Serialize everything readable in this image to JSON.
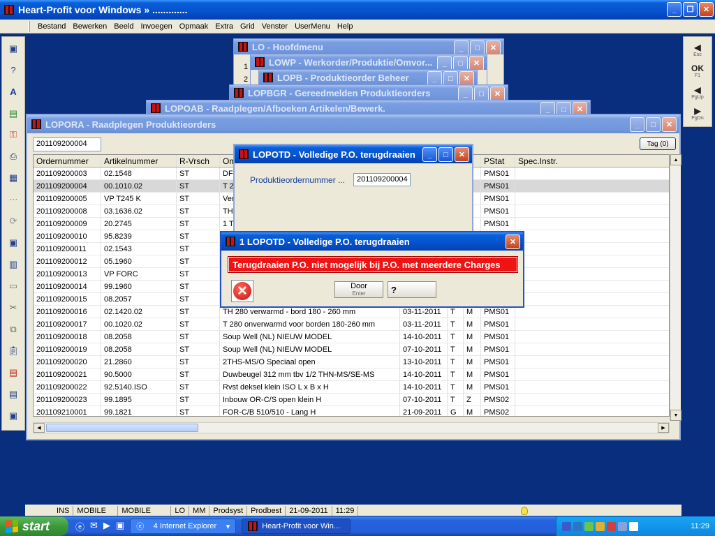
{
  "app": {
    "title": "Heart-Profit voor Windows  »  .............",
    "controls": [
      "minimize-icon",
      "restore-icon",
      "close-icon"
    ]
  },
  "menu": [
    "Bestand",
    "Bewerken",
    "Beeld",
    "Invoegen",
    "Opmaak",
    "Extra",
    "Grid",
    "Venster",
    "UserMenu",
    "Help"
  ],
  "right_toolbar": [
    {
      "big": "◀",
      "small": "Esc"
    },
    {
      "big": "OK",
      "small": "F1"
    },
    {
      "big": "◀",
      "small": "PgUp"
    },
    {
      "big": "▶",
      "small": "PgDn"
    }
  ],
  "windows": {
    "lo": {
      "title": "LO - Hoofdmenu",
      "side_digits": [
        "1",
        "2"
      ]
    },
    "lowp": {
      "title": "LOWP - Werkorder/Produktie/Omvor..."
    },
    "lopb": {
      "title": "LOPB - Produktieorder Beheer"
    },
    "lopbgr": {
      "title": "LOPBGR - Gereedmelden Produktieorders"
    },
    "lopoab": {
      "title": "LOPOAB - Raadplegen/Afboeken Artikelen/Bewerk."
    }
  },
  "lopora": {
    "title": "LOPORA - Raadplegen Produktieorders",
    "order_value": "201109200004",
    "tag_label": "Tag (0)",
    "columns": [
      "Ordernummer",
      "Artikelnummer",
      "R-Vrsch",
      "Om",
      "",
      "",
      "",
      "PStat",
      "Spec.Instr."
    ],
    "rows": [
      [
        "201109200003",
        "02.1548",
        "ST",
        "DFR",
        "",
        "",
        "",
        "PMS01",
        ""
      ],
      [
        "201109200004",
        "00.1010.02",
        "ST",
        "T 2",
        "",
        "",
        "",
        "PMS01",
        ""
      ],
      [
        "201109200005",
        "VP T245 K",
        "ST",
        "Verp",
        "",
        "",
        "",
        "PMS01",
        ""
      ],
      [
        "201109200008",
        "03.1636.02",
        "ST",
        "TH",
        "",
        "",
        "",
        "PMS01",
        ""
      ],
      [
        "201109200009",
        "20.2745",
        "ST",
        "1 T",
        "",
        "",
        "",
        "PMS01",
        ""
      ],
      [
        "201109200010",
        "95.8239",
        "ST",
        "",
        "",
        "",
        "",
        "",
        ""
      ],
      [
        "201109200011",
        "02.1543",
        "ST",
        "",
        "",
        "",
        "",
        "",
        ""
      ],
      [
        "201109200012",
        "05.1960",
        "ST",
        "",
        "",
        "",
        "",
        "",
        ""
      ],
      [
        "201109200013",
        "VP FORC",
        "ST",
        "",
        "",
        "",
        "",
        "",
        ""
      ],
      [
        "201109200014",
        "99.1960",
        "ST",
        "",
        "",
        "",
        "",
        "",
        ""
      ],
      [
        "201109200015",
        "08.2057",
        "ST",
        "",
        "",
        "",
        "",
        "",
        ""
      ],
      [
        "201109200016",
        "02.1420.02",
        "ST",
        "TH 280 verwarmd - bord 180 - 260 mm",
        "03-11-2011",
        "T",
        "M",
        "PMS01",
        ""
      ],
      [
        "201109200017",
        "00.1020.02",
        "ST",
        "T 280 onverwarmd voor borden 180-260 mm",
        "03-11-2011",
        "T",
        "M",
        "PMS01",
        ""
      ],
      [
        "201109200018",
        "08.2058",
        "ST",
        "Soup Well (NL) NIEUW MODEL",
        "14-10-2011",
        "T",
        "M",
        "PMS01",
        ""
      ],
      [
        "201109200019",
        "08.2058",
        "ST",
        "Soup Well (NL) NIEUW MODEL",
        "07-10-2011",
        "T",
        "M",
        "PMS01",
        ""
      ],
      [
        "201109200020",
        "21.2860",
        "ST",
        "2THS-MS/O Speciaal open",
        "13-10-2011",
        "T",
        "M",
        "PMS01",
        ""
      ],
      [
        "201109200021",
        "90.5000",
        "ST",
        "Duwbeugel 312 mm tbv 1/2 THN-MS/SE-MS",
        "14-10-2011",
        "T",
        "M",
        "PMS01",
        ""
      ],
      [
        "201109200022",
        "92.5140.ISO",
        "ST",
        "Rvst deksel klein ISO L x B x H",
        "14-10-2011",
        "T",
        "M",
        "PMS01",
        ""
      ],
      [
        "201109200023",
        "99.1895",
        "ST",
        "Inbouw OR-C/S open klein          H",
        "07-10-2011",
        "T",
        "Z",
        "PMS02",
        ""
      ],
      [
        "201109210001",
        "99.1821",
        "ST",
        "FOR-C/B 510/510 - Lang            H",
        "21-09-2011",
        "G",
        "M",
        "PMS02",
        ""
      ]
    ],
    "selected_row": 1
  },
  "lopotd": {
    "title": "LOPOTD - Volledige P.O. terugdraaien",
    "label": "Produktieordernummer ...",
    "value": "201109200004"
  },
  "dialog": {
    "title": "1 LOPOTD - Volledige P.O. terugdraaien",
    "message": "Terugdraaien P.O. niet mogelijk bij P.O. met meerdere Charges",
    "icon_glyph": "✕",
    "door_label": "Door",
    "door_sub": "Enter",
    "help_glyph": "?"
  },
  "status": [
    "INS",
    "MOBILE",
    "MOBILE",
    "LO",
    "MM",
    "Prodsyst",
    "Prodbest",
    "21-09-2011",
    "11:29"
  ],
  "taskbar": {
    "start": "start",
    "tasks": [
      {
        "label": "4 Internet Explorer",
        "icon": "ie-icon"
      },
      {
        "label": "Heart-Profit voor Win...",
        "icon": "heart-profit-icon"
      }
    ],
    "clock": "11:29"
  },
  "colors": {
    "desktop": "#0a2e7e",
    "error_banner": "#ee1414",
    "xp_title": "#0552cc"
  }
}
